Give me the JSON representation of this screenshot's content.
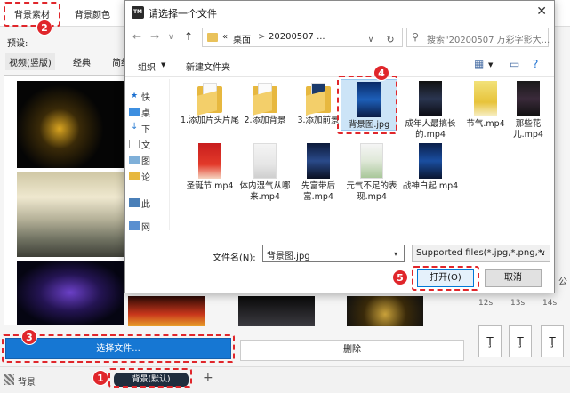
{
  "app": {
    "tabs": [
      "背景素材",
      "背景颜色"
    ],
    "preset_label": "预设:",
    "subtabs": [
      "视频(竖版)",
      "经典",
      "简约"
    ],
    "select_file_label": "选择文件...",
    "delete_label": "删除",
    "track_label": "背景",
    "track_clip_label": "背景(默认)",
    "add_icon": "plus-icon",
    "ruler_ticks": [
      "12s",
      "13s",
      "14s"
    ],
    "side_label": "公"
  },
  "callouts": {
    "badges": [
      "1",
      "2",
      "3",
      "4",
      "5"
    ]
  },
  "dialog": {
    "title": "请选择一个文件",
    "app_icon_text": "TM",
    "address": {
      "prefix": "«",
      "crumbs": [
        "桌面",
        "20200507 ..."
      ],
      "separator": ">"
    },
    "search_placeholder": "搜索\"20200507 万彩字影大...",
    "toolbar": {
      "organize": "组织",
      "new_folder": "新建文件夹"
    },
    "nav_items": [
      "快",
      "桌",
      "下",
      "文",
      "图",
      "论",
      "此",
      "网"
    ],
    "files": [
      {
        "name": "1.添加片头片尾",
        "type": "folder"
      },
      {
        "name": "2.添加背景",
        "type": "folder"
      },
      {
        "name": "3.添加前景",
        "type": "folder"
      },
      {
        "name": "背景图.jpg",
        "type": "image",
        "selected": true
      },
      {
        "name": "成年人最搞长的.mp4",
        "type": "video"
      },
      {
        "name": "节气.mp4",
        "type": "video"
      },
      {
        "name": "那些花儿.mp4",
        "type": "video"
      },
      {
        "name": "圣诞节.mp4",
        "type": "video"
      },
      {
        "name": "体内湿气从哪来.mp4",
        "type": "video"
      },
      {
        "name": "先富带后富.mp4",
        "type": "video"
      },
      {
        "name": "元气不足的表现.mp4",
        "type": "video"
      },
      {
        "name": "战神白起.mp4",
        "type": "video"
      }
    ],
    "filename_label": "文件名(N):",
    "filename_value": "背景图.jpg",
    "filter_value": "Supported files(*.jpg,*.png,*.",
    "open_label": "打开(O)",
    "cancel_label": "取消"
  },
  "colors": {
    "accent": "#1677d3",
    "callout": "#e0262b",
    "folder": "#e7b83f"
  }
}
